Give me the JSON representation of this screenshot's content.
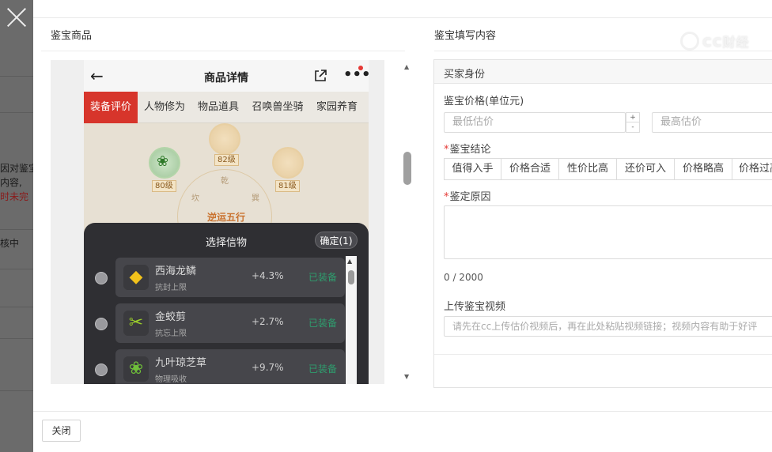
{
  "backdrop": {
    "fragments": [
      "因对鉴宝",
      "内容,",
      "时未完",
      "核中"
    ]
  },
  "watermark": {
    "text": "CC财经"
  },
  "left_section": {
    "title": "鉴宝商品"
  },
  "right_section": {
    "title": "鉴宝填写内容"
  },
  "phone": {
    "header_title": "商品详情",
    "tabs": [
      "装备评价",
      "人物修为",
      "物品道具",
      "召唤兽坐骑",
      "家园养育"
    ],
    "active_tab": "装备评价",
    "levels": [
      "82级",
      "80级",
      "81级"
    ],
    "center_label": "逆运五行",
    "ring_chars": [
      "乾",
      "坎",
      "巽"
    ],
    "sheet": {
      "title": "选择信物",
      "confirm": "确定(1)",
      "items": [
        {
          "name": "西海龙鳞",
          "attr": "抗封上限",
          "pct": "+4.3%",
          "status": "已装备",
          "icon": "yellow-scale-icon"
        },
        {
          "name": "金蛟剪",
          "attr": "抗忘上限",
          "pct": "+2.7%",
          "status": "已装备",
          "icon": "golden-scissors-icon"
        },
        {
          "name": "九叶琼芝草",
          "attr": "物理吸收",
          "pct": "+9.7%",
          "status": "已装备",
          "icon": "green-herb-icon"
        }
      ]
    }
  },
  "form": {
    "subhead": "买家身份",
    "price_label": "鉴宝价格(单位元)",
    "min_placeholder": "最低估价",
    "max_placeholder": "最高估价",
    "stepper_up": "+",
    "stepper_down": "-",
    "conclusion_label": "鉴宝结论",
    "conclusion_options": [
      "值得入手",
      "价格合适",
      "性价比高",
      "还价可入",
      "价格略高",
      "价格过高"
    ],
    "reason_label": "鉴定原因",
    "counter": "0 / 2000",
    "video_label": "上传鉴宝视频",
    "video_placeholder": "请先在cc上传估价视频后，再在此处粘贴视频链接；视频内容有助于好评"
  },
  "footer": {
    "close_label": "关闭"
  },
  "colors": {
    "accent_red": "#d7352b",
    "equipped_green": "#2e9e6e",
    "required": "#e53935"
  }
}
